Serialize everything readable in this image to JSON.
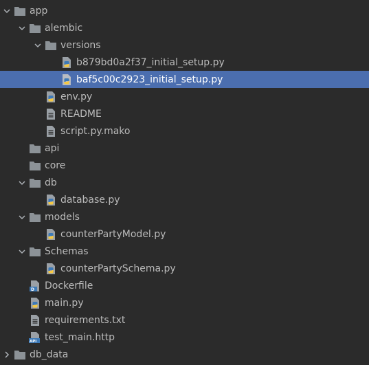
{
  "tree": {
    "items": [
      {
        "label": "app",
        "type": "folder",
        "expanded": true
      },
      {
        "label": "alembic",
        "type": "folder",
        "expanded": true
      },
      {
        "label": "versions",
        "type": "folder",
        "expanded": true
      },
      {
        "label": "b879bd0a2f37_initial_setup.py",
        "type": "python-file"
      },
      {
        "label": "baf5c00c2923_initial_setup.py",
        "type": "python-file",
        "selected": true
      },
      {
        "label": "env.py",
        "type": "python-file"
      },
      {
        "label": "README",
        "type": "text-file"
      },
      {
        "label": "script.py.mako",
        "type": "text-file"
      },
      {
        "label": "api",
        "type": "folder",
        "expanded": false
      },
      {
        "label": "core",
        "type": "folder",
        "expanded": false
      },
      {
        "label": "db",
        "type": "folder",
        "expanded": true
      },
      {
        "label": "database.py",
        "type": "python-file"
      },
      {
        "label": "models",
        "type": "folder",
        "expanded": true
      },
      {
        "label": "counterPartyModel.py",
        "type": "python-file"
      },
      {
        "label": "Schemas",
        "type": "folder",
        "expanded": true
      },
      {
        "label": "counterPartySchema.py",
        "type": "python-file"
      },
      {
        "label": "Dockerfile",
        "type": "docker-file"
      },
      {
        "label": "main.py",
        "type": "python-file"
      },
      {
        "label": "requirements.txt",
        "type": "text-file"
      },
      {
        "label": "test_main.http",
        "type": "http-file"
      },
      {
        "label": "db_data",
        "type": "folder",
        "expanded": false
      }
    ]
  },
  "colors": {
    "background": "#2b2b2b",
    "selection": "#4b6eaf",
    "text": "#bbbbbb",
    "folder": "#8c9297",
    "python_blue": "#3d7ab8",
    "python_yellow": "#f5c843"
  }
}
